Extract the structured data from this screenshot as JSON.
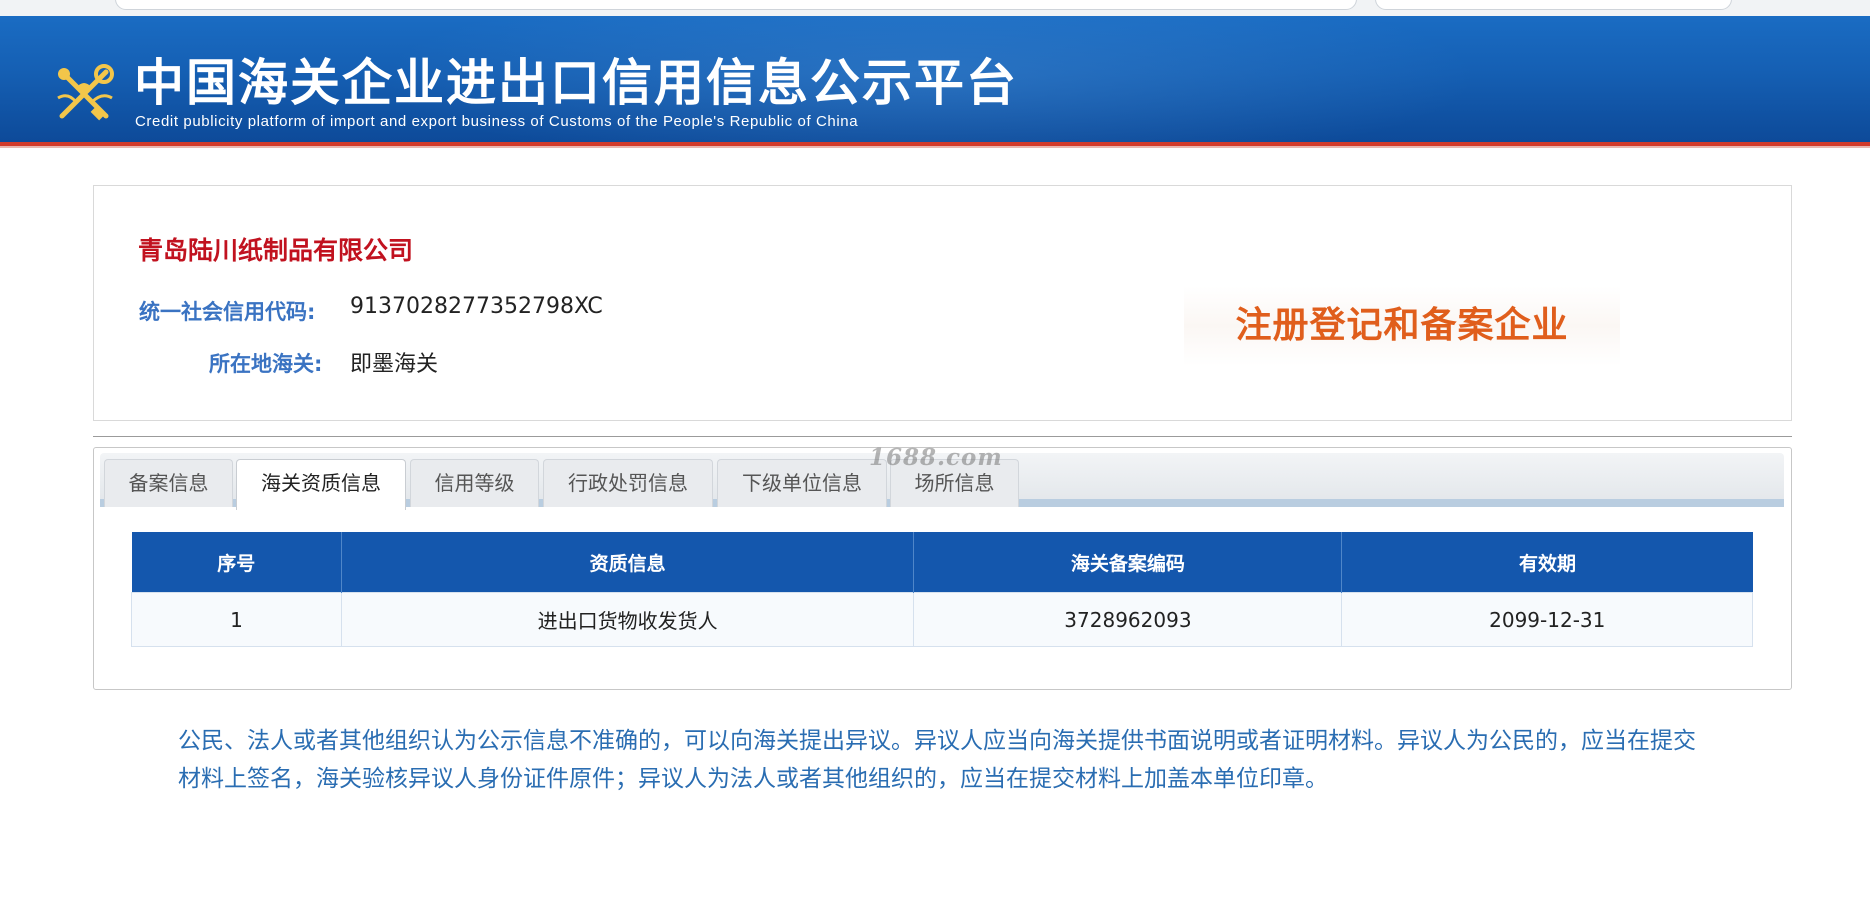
{
  "header": {
    "title": "中国海关企业进出口信用信息公示平台",
    "subtitle": "Credit publicity platform of import and export business of Customs of the People's Republic of China"
  },
  "company": {
    "name": "青岛陆川纸制品有限公司",
    "credit_code_label": "统一社会信用代码:",
    "credit_code": "9137028277352798XC",
    "customs_label": "所在地海关:",
    "customs": "即墨海关",
    "registration_status": "注册登记和备案企业"
  },
  "tabs": [
    {
      "label": "备案信息",
      "active": false
    },
    {
      "label": "海关资质信息",
      "active": true
    },
    {
      "label": "信用等级",
      "active": false
    },
    {
      "label": "行政处罚信息",
      "active": false
    },
    {
      "label": "下级单位信息",
      "active": false
    },
    {
      "label": "场所信息",
      "active": false
    }
  ],
  "watermark": "1688.com",
  "table": {
    "headers": [
      "序号",
      "资质信息",
      "海关备案编码",
      "有效期"
    ],
    "rows": [
      [
        "1",
        "进出口货物收发货人",
        "3728962093",
        "2099-12-31"
      ]
    ]
  },
  "notice": "公民、法人或者其他组织认为公示信息不准确的，可以向海关提出异议。异议人应当向海关提供书面说明或者证明材料。异议人为公民的，应当在提交材料上签名，海关验核异议人身份证件原件；异议人为法人或者其他组织的，应当在提交材料上加盖本单位印章。",
  "colors": {
    "header_blue": "#155fb3",
    "header_red_line": "#d23b2b",
    "company_name": "#c1121f",
    "label_blue": "#3a73c2",
    "stamp_orange": "#e05e1c",
    "table_header": "#1457ad",
    "notice_text": "#2a6db2"
  }
}
